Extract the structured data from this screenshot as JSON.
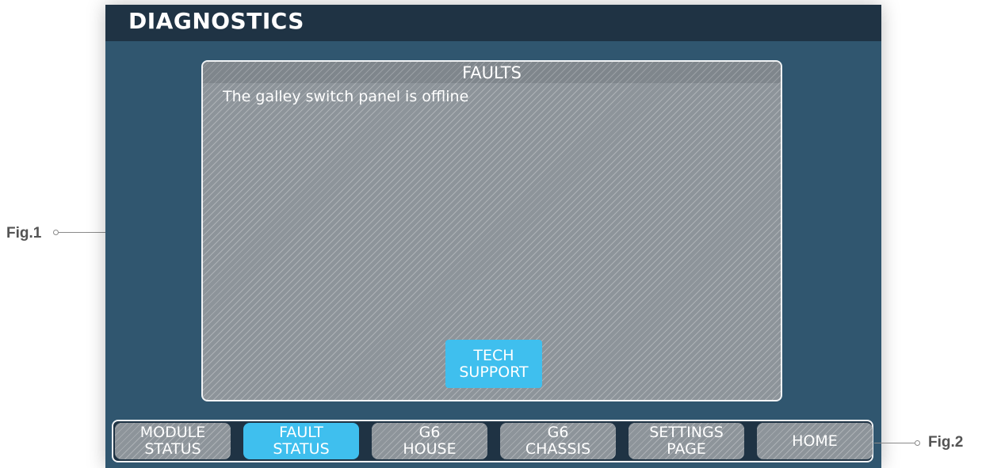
{
  "header": {
    "title": "DIAGNOSTICS"
  },
  "faults_panel": {
    "title": "FAULTS",
    "messages": [
      "The galley switch panel is offline"
    ],
    "tech_support": {
      "line1": "TECH",
      "line2": "SUPPORT"
    }
  },
  "nav": {
    "items": [
      {
        "line1": "MODULE",
        "line2": "STATUS",
        "active": false
      },
      {
        "line1": "FAULT",
        "line2": "STATUS",
        "active": true
      },
      {
        "line1": "G6",
        "line2": "HOUSE",
        "active": false
      },
      {
        "line1": "G6",
        "line2": "CHASSIS",
        "active": false
      },
      {
        "line1": "SETTINGS",
        "line2": "PAGE",
        "active": false
      },
      {
        "line1": "HOME",
        "line2": "",
        "active": false
      }
    ]
  },
  "callouts": {
    "fig1": "Fig.1",
    "fig2": "Fig.2"
  },
  "colors": {
    "title_bar": "#1f3344",
    "screen_bg": "#30566f",
    "panel_hatch": "#8d949a",
    "active_button": "#3fbfee",
    "border": "#f2f4f6"
  }
}
